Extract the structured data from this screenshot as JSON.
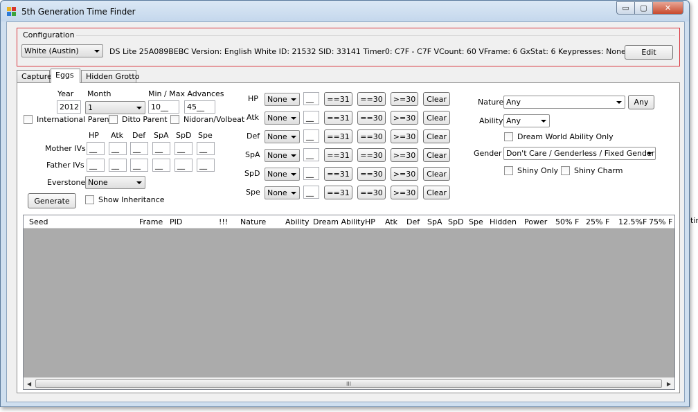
{
  "window": {
    "title": "5th Generation Time Finder",
    "buttons": {
      "minimize": "▭",
      "maximize": "▢",
      "close": "✕"
    }
  },
  "config": {
    "group_label": "Configuration",
    "profile": "White (Austin)",
    "info": "DS Lite 25A089BEBC Version: English White ID: 21532 SID: 33141 Timer0: C7F - C7F VCount: 60 VFrame: 6 GxStat: 6 Keypresses: None",
    "edit_label": "Edit"
  },
  "tabs": [
    {
      "label": "Capture"
    },
    {
      "label": "Eggs"
    },
    {
      "label": "Hidden Grotto"
    }
  ],
  "eggs": {
    "year_label": "Year",
    "year": "2012",
    "month_label": "Month",
    "month": "1",
    "advances_label": "Min / Max Advances",
    "min_adv": "10__",
    "max_adv": "45__",
    "checks": {
      "international": "International Parents",
      "ditto": "Ditto Parent",
      "nidoran": "Nidoran/Volbeat",
      "show_inheritance": "Show Inheritance",
      "dream_world": "Dream World Ability Only",
      "shiny_only": "Shiny Only",
      "shiny_charm": "Shiny Charm"
    },
    "iv_headers": [
      "HP",
      "Atk",
      "Def",
      "SpA",
      "SpD",
      "Spe"
    ],
    "mother_label": "Mother IVs",
    "father_label": "Father IVs",
    "mother_ivs": [
      "__",
      "__",
      "__",
      "__",
      "__",
      "__"
    ],
    "father_ivs": [
      "__",
      "__",
      "__",
      "__",
      "__",
      "__"
    ],
    "everstone_label": "Everstone",
    "everstone": "None",
    "generate_label": "Generate"
  },
  "iv_filters": [
    {
      "stat": "HP",
      "mode": "None",
      "value": "__"
    },
    {
      "stat": "Atk",
      "mode": "None",
      "value": "__"
    },
    {
      "stat": "Def",
      "mode": "None",
      "value": "__"
    },
    {
      "stat": "SpA",
      "mode": "None",
      "value": "__"
    },
    {
      "stat": "SpD",
      "mode": "None",
      "value": "__"
    },
    {
      "stat": "Spe",
      "mode": "None",
      "value": "__"
    }
  ],
  "filter_buttons": {
    "eq31": "==31",
    "eq30": "==30",
    "ge30": ">=30",
    "clear": "Clear"
  },
  "right_filters": {
    "nature_label": "Nature",
    "nature": "Any",
    "nature_any_btn": "Any",
    "ability_label": "Ability",
    "ability": "Any",
    "gender_label": "Gender",
    "gender": "Don't Care / Genderless / Fixed Gender"
  },
  "grid": {
    "columns": [
      "Seed",
      "Frame",
      "PID",
      "!!!",
      "Nature",
      "Ability",
      "Dream Ability",
      "HP",
      "Atk",
      "Def",
      "SpA",
      "SpD",
      "Spe",
      "Hidden",
      "Power",
      "50% F",
      "25% F",
      "12.5%F",
      "75% F"
    ],
    "scroll_grip": "III"
  },
  "offscreen_text": "tin"
}
